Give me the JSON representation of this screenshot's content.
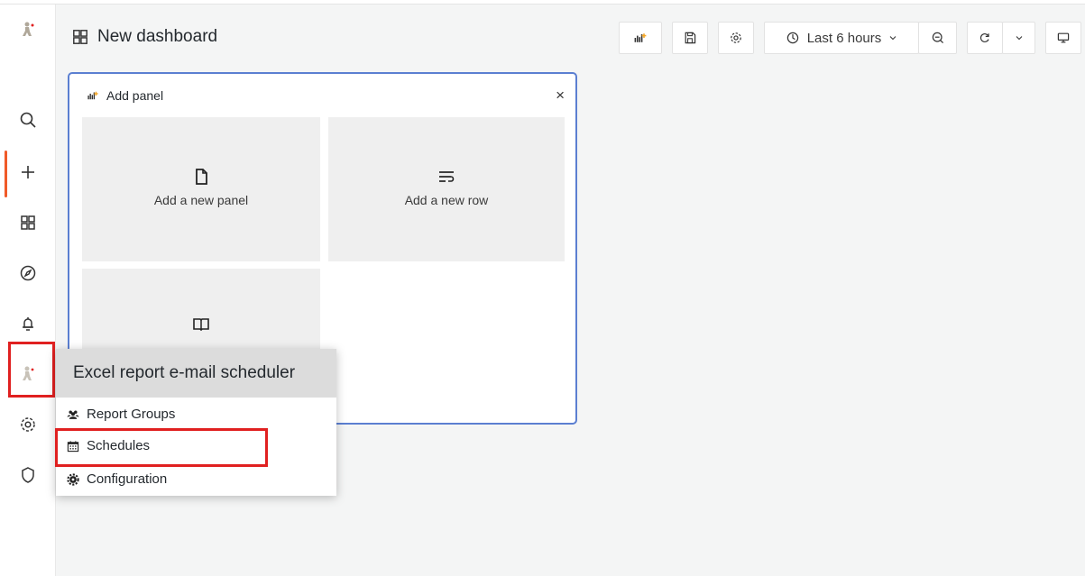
{
  "header": {
    "dashboard_title": "New dashboard",
    "time_range_label": "Last 6 hours"
  },
  "add_panel": {
    "title": "Add panel",
    "close_label": "×",
    "cards": [
      {
        "label": "Add a new panel",
        "icon": "file-icon"
      },
      {
        "label": "Add a new row",
        "icon": "add-row-icon"
      },
      {
        "label": "",
        "icon": "library-book-icon"
      }
    ]
  },
  "sidebar": {
    "items": [
      {
        "name": "app-logo-icon"
      },
      {
        "name": "search-icon"
      },
      {
        "name": "plus-icon"
      },
      {
        "name": "dashboards-icon"
      },
      {
        "name": "explore-compass-icon"
      },
      {
        "name": "alert-bell-icon"
      },
      {
        "name": "report-scheduler-icon"
      },
      {
        "name": "gear-icon"
      },
      {
        "name": "shield-icon"
      }
    ]
  },
  "plugin_menu": {
    "title": "Excel report e-mail scheduler",
    "items": [
      {
        "label": "Report Groups",
        "icon": "users-icon"
      },
      {
        "label": "Schedules",
        "icon": "calendar-icon"
      },
      {
        "label": "Configuration",
        "icon": "cog-icon"
      }
    ]
  },
  "colors": {
    "accent_orange": "#f05a28",
    "panel_border_blue": "#5b7fd1",
    "highlight_red": "#e02020"
  }
}
